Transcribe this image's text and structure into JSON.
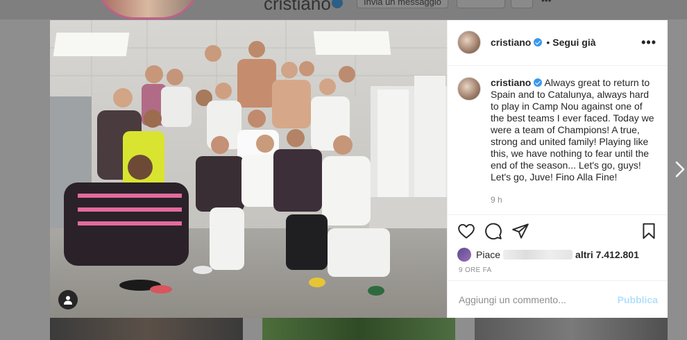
{
  "background_profile": {
    "username": "cristiano",
    "message_button": "Invia un messaggio"
  },
  "post": {
    "header": {
      "username": "cristiano",
      "follow_state": "Segui già",
      "more_icon": "ellipsis-icon"
    },
    "caption": {
      "username": "cristiano",
      "text": "Always great to return to Spain and to Catalunya, always hard to play in Camp Nou against one of the best teams I ever faced. Today we were a team of Champions! A true, strong and united family! Playing like this, we have nothing to fear until the end of the season... Let's go, guys! Let's go, Juve! Fino Alla Fine!",
      "time": "9 h"
    },
    "actions": {
      "like_icon": "heart-icon",
      "comment_icon": "comment-icon",
      "share_icon": "paper-plane-icon",
      "save_icon": "bookmark-icon"
    },
    "likes": {
      "prefix": "Piace",
      "suffix": "altri 7.412.801"
    },
    "timestamp": "9 ORE FA",
    "comment": {
      "placeholder": "Aggiungi un commento...",
      "publish_label": "Pubblica"
    }
  },
  "colors": {
    "accent_blue": "#3897f0",
    "publish_disabled": "#b2dffc",
    "overlay": "#8e8e8e"
  }
}
